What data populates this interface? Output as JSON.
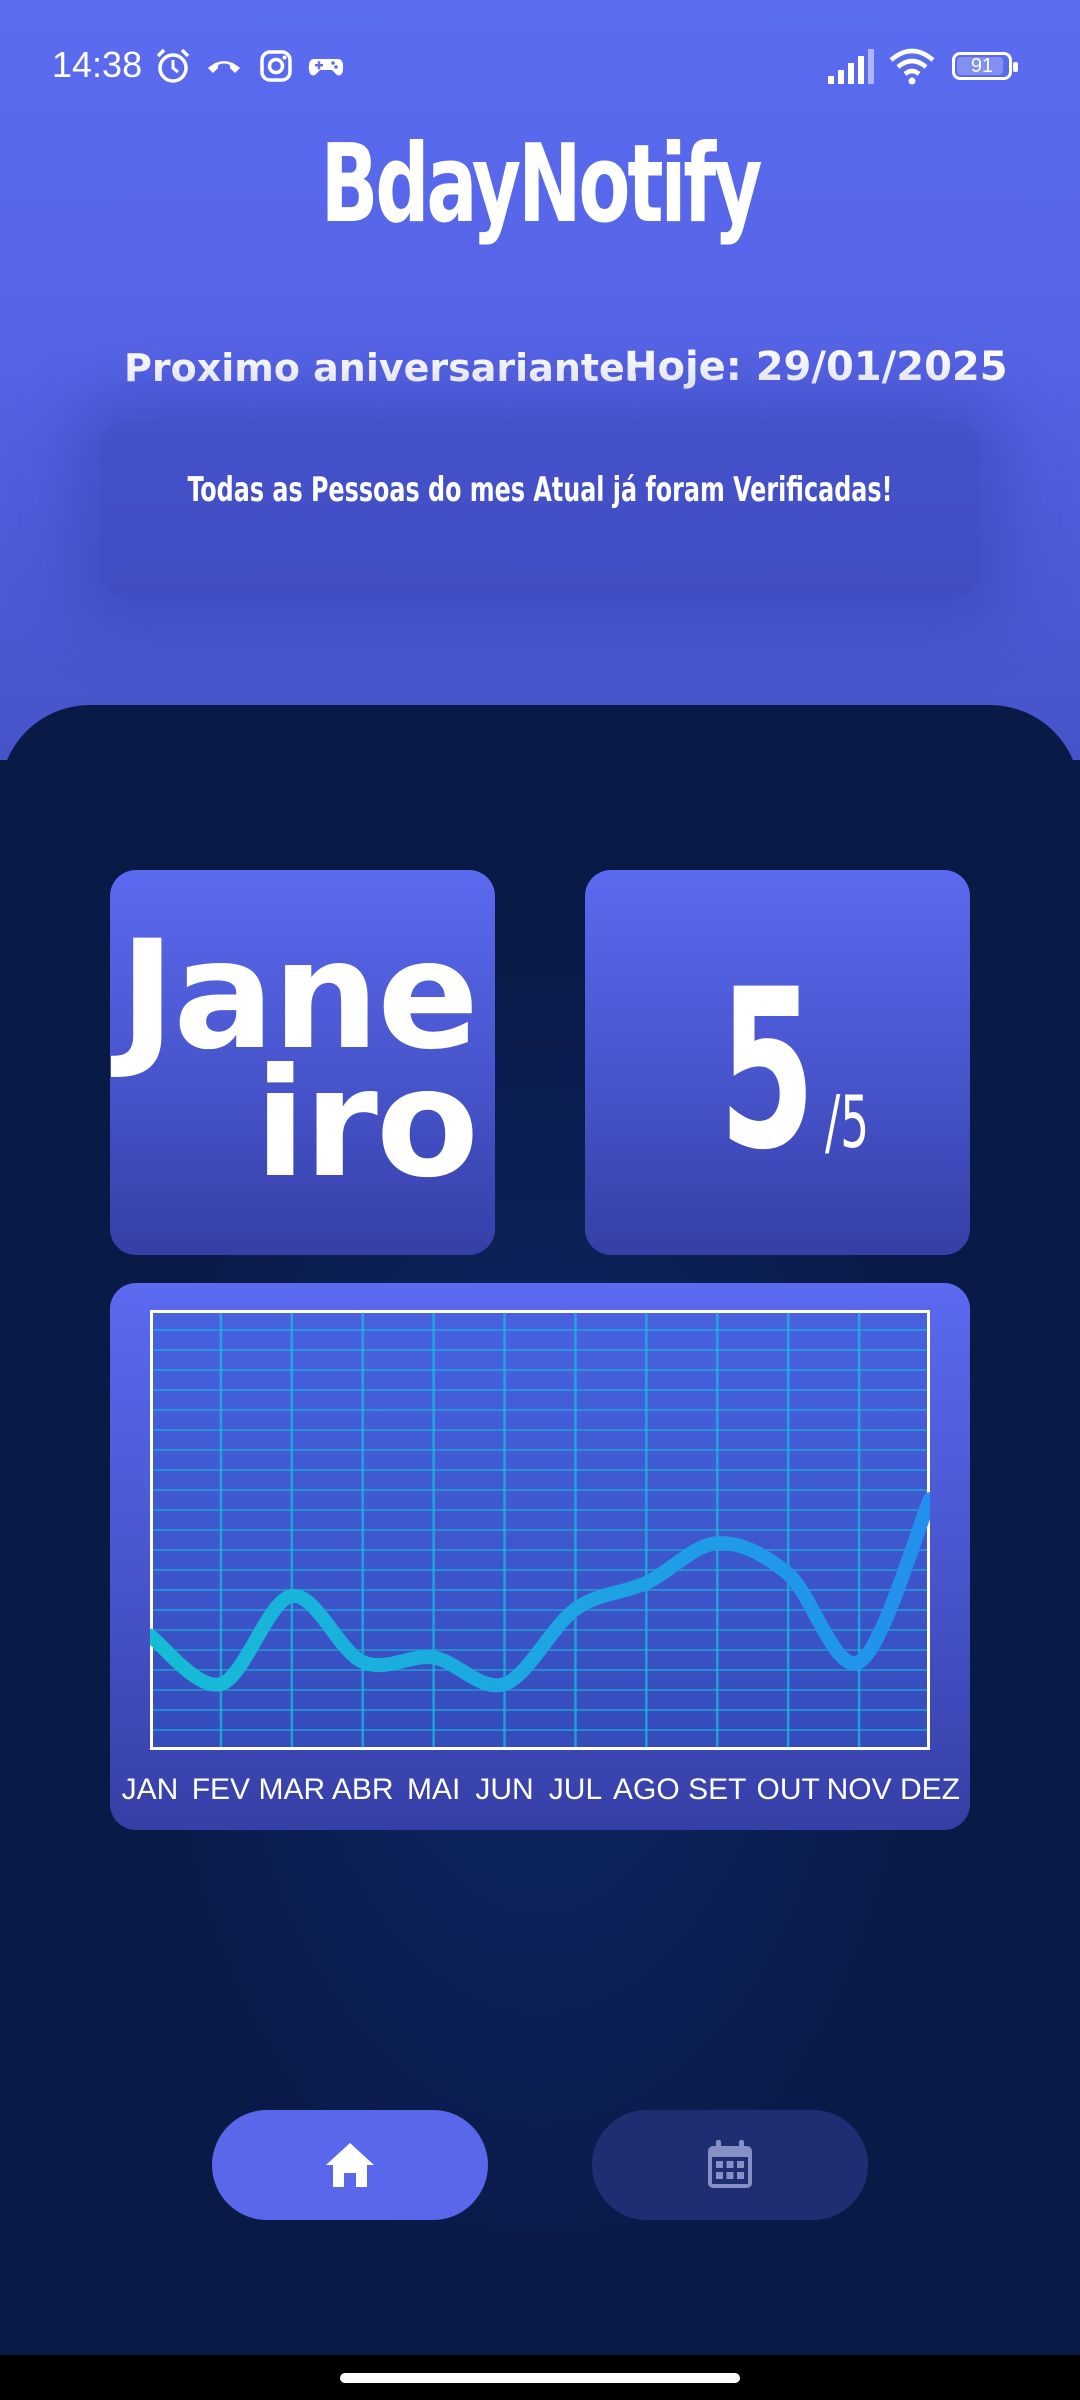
{
  "status_bar": {
    "time": "14:38",
    "icons": [
      "alarm-icon",
      "call-icon",
      "instagram-icon",
      "gamepad-icon",
      "signal-icon",
      "wifi-icon"
    ],
    "battery": "91",
    "battery_level_percent": 91
  },
  "app": {
    "title": "BdayNotify"
  },
  "header": {
    "next_birthday_label": "Proximo aniversariante:",
    "today_label": "Hoje: 29/01/2025"
  },
  "notice": {
    "text": "Todas as Pessoas do mes Atual já foram Verificadas!"
  },
  "month_card": {
    "line1": "Jane",
    "line2": "iro"
  },
  "count_card": {
    "numerator": "5",
    "denominator": "/5"
  },
  "chart_data": {
    "type": "line",
    "categories": [
      "JAN",
      "FEV",
      "MAR",
      "ABR",
      "MAI",
      "JUN",
      "JUL",
      "AGO",
      "SET",
      "OUT",
      "NOV",
      "DEZ"
    ],
    "series": [
      {
        "values": [
          2.6,
          1.5,
          3.5,
          2.0,
          2.1,
          1.5,
          3.2,
          3.8,
          4.7,
          4.0,
          2.0,
          5.7
        ]
      }
    ],
    "ylim": [
      0,
      10
    ],
    "grid": true,
    "colors": {
      "line_start": "#16bcd6",
      "line_end": "#2290ee",
      "grid": "#1bb8e0",
      "frame": "#ffffff"
    }
  },
  "nav": {
    "home": {
      "icon": "home-icon",
      "active": true
    },
    "calendar": {
      "icon": "calendar-icon",
      "active": false
    }
  },
  "colors": {
    "accent": "#5a67ea",
    "background": "#0a1a47",
    "inactive_nav": "#1f2d72"
  }
}
